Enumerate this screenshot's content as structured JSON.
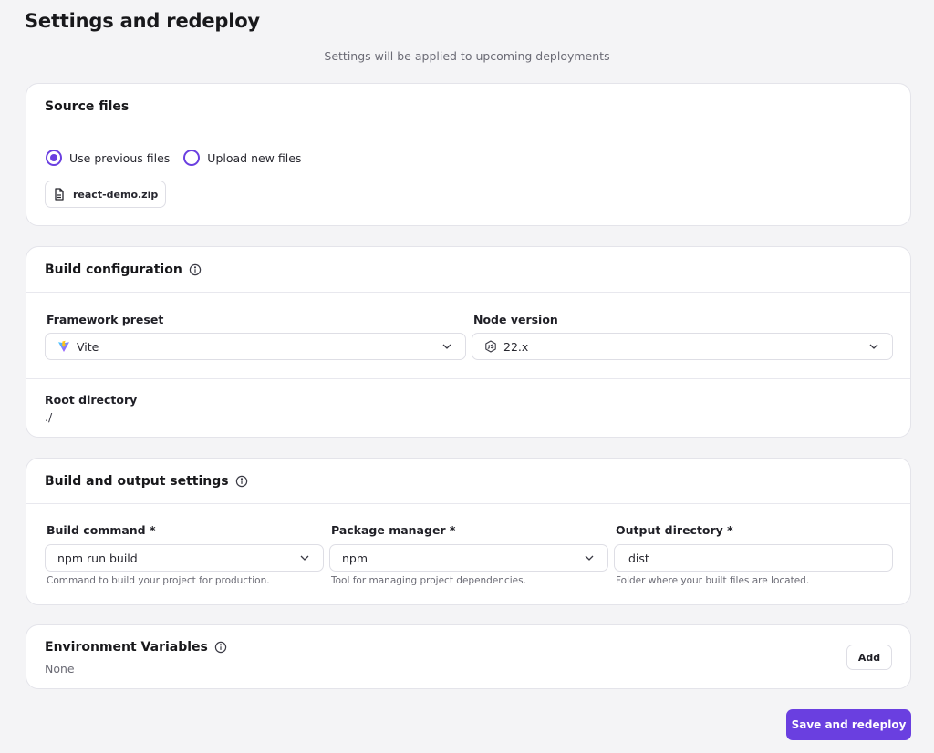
{
  "page": {
    "title": "Settings and redeploy",
    "subtitle": "Settings will be applied to upcoming deployments"
  },
  "source_files": {
    "title": "Source files",
    "options": [
      {
        "label": "Use previous files",
        "selected": true
      },
      {
        "label": "Upload new files",
        "selected": false
      }
    ],
    "file_name": "react-demo.zip",
    "file_icon": "file-icon"
  },
  "build_configuration": {
    "title": "Build configuration",
    "info_icon": "info-icon",
    "framework_preset": {
      "label": "Framework preset",
      "value": "Vite",
      "icon": "vite-logo-icon"
    },
    "node_version": {
      "label": "Node version",
      "value": "22.x",
      "icon": "nodejs-icon"
    },
    "root_directory": {
      "label": "Root directory",
      "value": "./"
    }
  },
  "build_output": {
    "title": "Build and output settings",
    "build_command": {
      "label": "Build command *",
      "value": "npm run build",
      "helper": "Command to build your project for production."
    },
    "package_manager": {
      "label": "Package manager *",
      "value": "npm",
      "helper": "Tool for managing project dependencies."
    },
    "output_directory": {
      "label": "Output directory *",
      "value": "dist",
      "helper": "Folder where your built files are located."
    }
  },
  "env_vars": {
    "title": "Environment Variables",
    "value": "None",
    "add_label": "Add"
  },
  "actions": {
    "save_label": "Save and redeploy"
  },
  "colors": {
    "accent": "#6a3fe0",
    "background": "#f4f4f6",
    "card": "#ffffff",
    "border": "#e4e4ea"
  }
}
